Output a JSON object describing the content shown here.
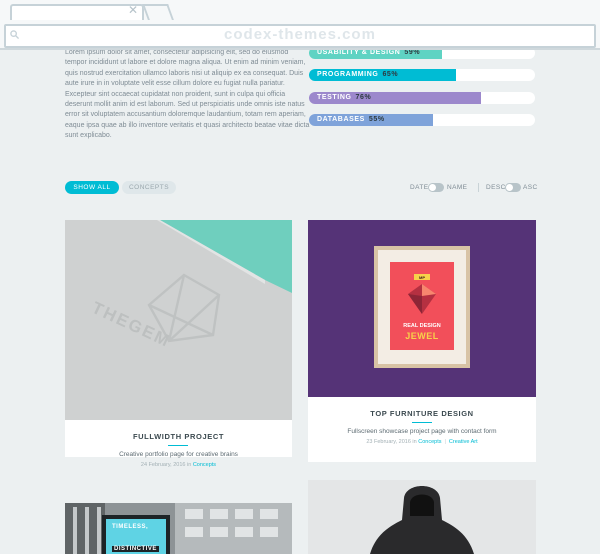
{
  "browser": {
    "url": "codex-themes.com"
  },
  "about": {
    "text": "Lorem ipsum dolor sit amet, consectetur adipisicing elit, sed do eiusmod tempor incididunt ut labore et dolore magna aliqua. Ut enim ad minim veniam, quis nostrud exercitation ullamco laboris nisi ut aliquip ex ea consequat. Duis aute irure in in voluptate velit esse cillum dolore eu fugiat nulla pariatur. Excepteur sint occaecat cupidatat non proident, sunt in culpa qui officia deserunt mollit anim id est laborum. Sed ut perspiciatis unde omnis iste natus error sit voluptatem accusantium doloremque laudantium, totam rem aperiam, eaque ipsa quae ab illo inventore veritatis et quasi architecto beatae vitae dicta sunt explicabo."
  },
  "skills": [
    {
      "label": "USABILITY & DESIGN",
      "percent": "59%",
      "value": 0.59,
      "color": "#5fd3c3"
    },
    {
      "label": "PROGRAMMING",
      "percent": "65%",
      "value": 0.65,
      "color": "#00bcd4"
    },
    {
      "label": "TESTING",
      "percent": "76%",
      "value": 0.76,
      "color": "#9c88cc"
    },
    {
      "label": "DATABASES",
      "percent": "55%",
      "value": 0.55,
      "color": "#7fa3da"
    }
  ],
  "filters": {
    "show_all": "SHOW ALL",
    "concepts": "CONCEPTS"
  },
  "sort": {
    "date": "DATE",
    "name": "NAME",
    "desc": "DESC",
    "asc": "ASC"
  },
  "cards": [
    {
      "title": "FULLWIDTH PROJECT",
      "description": "Creative portfolio page for creative brains",
      "date": "24 February, 2016 in",
      "category": "Concepts",
      "logo_text": "THEGEM"
    },
    {
      "title": "TOP FURNITURE DESIGN",
      "description": "Fullscreen showcase project page with contact form",
      "date": "23 February, 2016 in",
      "category": "Concepts",
      "category2": "Creative Art",
      "poster_top": "REAL DESIGN",
      "poster_main": "JEWEL",
      "poster_badge": "MP"
    },
    {
      "poster_line1": "TIMELESS,",
      "poster_line2": "DISTINCTIVE"
    }
  ]
}
